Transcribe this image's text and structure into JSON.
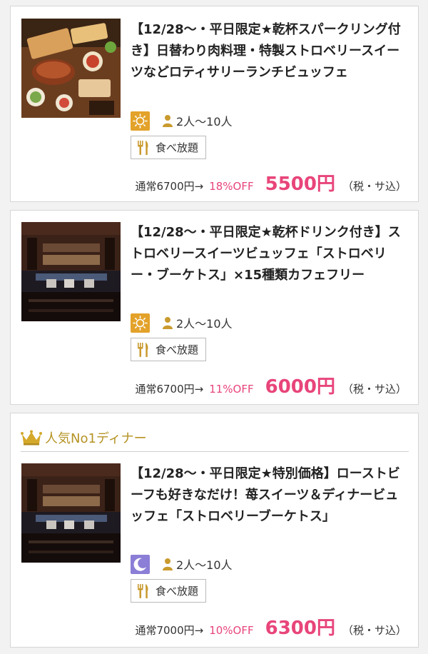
{
  "plans": [
    {
      "title": "【12/28〜・平日限定★乾杯スパークリング付き】日替わり肉料理・特製ストロベリースイーツなどロティサリーランチビュッフェ",
      "time_icon": "sun-icon",
      "people": "2人〜10人",
      "badge": "食べ放題",
      "regular_price": "通常6700円→",
      "discount": "18%OFF",
      "price": "5500円",
      "tax": "（税・サ込）"
    },
    {
      "title": "【12/28〜・平日限定★乾杯ドリンク付き】ストロベリースイーツビュッフェ「ストロベリー・ブーケトス」×15種類カフェフリー",
      "time_icon": "sun-icon",
      "people": "2人〜10人",
      "badge": "食べ放題",
      "regular_price": "通常6700円→",
      "discount": "11%OFF",
      "price": "6000円",
      "tax": "（税・サ込）"
    },
    {
      "rank_label": "人気No1ディナー",
      "title": "【12/28〜・平日限定★特別価格】ローストビーフも好きなだけ！苺スイーツ＆ディナービュッフェ「ストロベリーブーケトス」",
      "time_icon": "moon-icon",
      "people": "2人〜10人",
      "badge": "食べ放題",
      "regular_price": "通常7000円→",
      "discount": "10%OFF",
      "price": "6300円",
      "tax": "（税・サ込）"
    }
  ],
  "colors": {
    "accent_pink": "#e8457a",
    "sun_badge": "#e3a22a",
    "moon_badge": "#8a7ed6",
    "rank_gold": "#b59324"
  }
}
